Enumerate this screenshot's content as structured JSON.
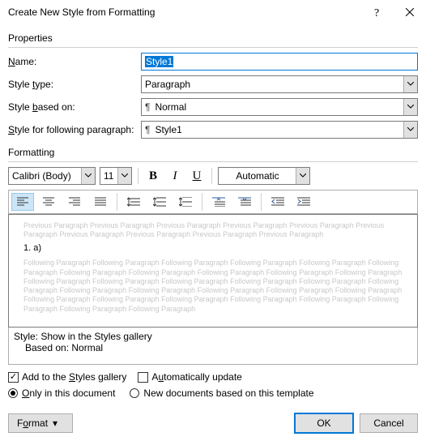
{
  "titlebar": {
    "title": "Create New Style from Formatting"
  },
  "sections": {
    "properties": "Properties",
    "formatting": "Formatting"
  },
  "labels": {
    "name_pre": "",
    "name_u": "N",
    "name_post": "ame:",
    "type_pre": "Style ",
    "type_u": "t",
    "type_post": "ype:",
    "based_pre": "Style ",
    "based_u": "b",
    "based_post": "ased on:",
    "follow_pre": "",
    "follow_u": "S",
    "follow_post": "tyle for following paragraph:"
  },
  "fields": {
    "name": "Style1",
    "type": "Paragraph",
    "based_on": "Normal",
    "following": "Style1"
  },
  "font": {
    "family": "Calibri (Body)",
    "size": "11",
    "color_label": "Automatic"
  },
  "preview": {
    "ghost_prev": "Previous Paragraph Previous Paragraph Previous Paragraph Previous Paragraph Previous Paragraph Previous Paragraph Previous Paragraph Previous Paragraph Previous Paragraph Previous Paragraph",
    "sample": "1.            a)",
    "ghost_follow": "Following Paragraph Following Paragraph Following Paragraph Following Paragraph Following Paragraph Following Paragraph Following Paragraph Following Paragraph Following Paragraph Following Paragraph Following Paragraph Following Paragraph Following Paragraph Following Paragraph Following Paragraph Following Paragraph Following Paragraph Following Paragraph Following Paragraph Following Paragraph Following Paragraph Following Paragraph Following Paragraph Following Paragraph Following Paragraph Following Paragraph Following Paragraph Following Paragraph Following Paragraph Following Paragraph"
  },
  "desc": {
    "line1": "Style: Show in the Styles gallery",
    "line2": "Based on: Normal"
  },
  "checks": {
    "add_pre": "Add to the ",
    "add_u": "S",
    "add_post": "tyles gallery",
    "auto_pre": "A",
    "auto_u": "u",
    "auto_post": "tomatically update"
  },
  "radios": {
    "only_pre": "",
    "only_u": "O",
    "only_post": "nly in this document",
    "new_label": "New documents based on this template"
  },
  "footer": {
    "format_pre": "F",
    "format_u": "o",
    "format_post": "rmat",
    "ok": "OK",
    "cancel": "Cancel"
  },
  "icon_names": {
    "help": "help-icon",
    "close": "close-icon",
    "chevron": "chevron-down-icon"
  }
}
